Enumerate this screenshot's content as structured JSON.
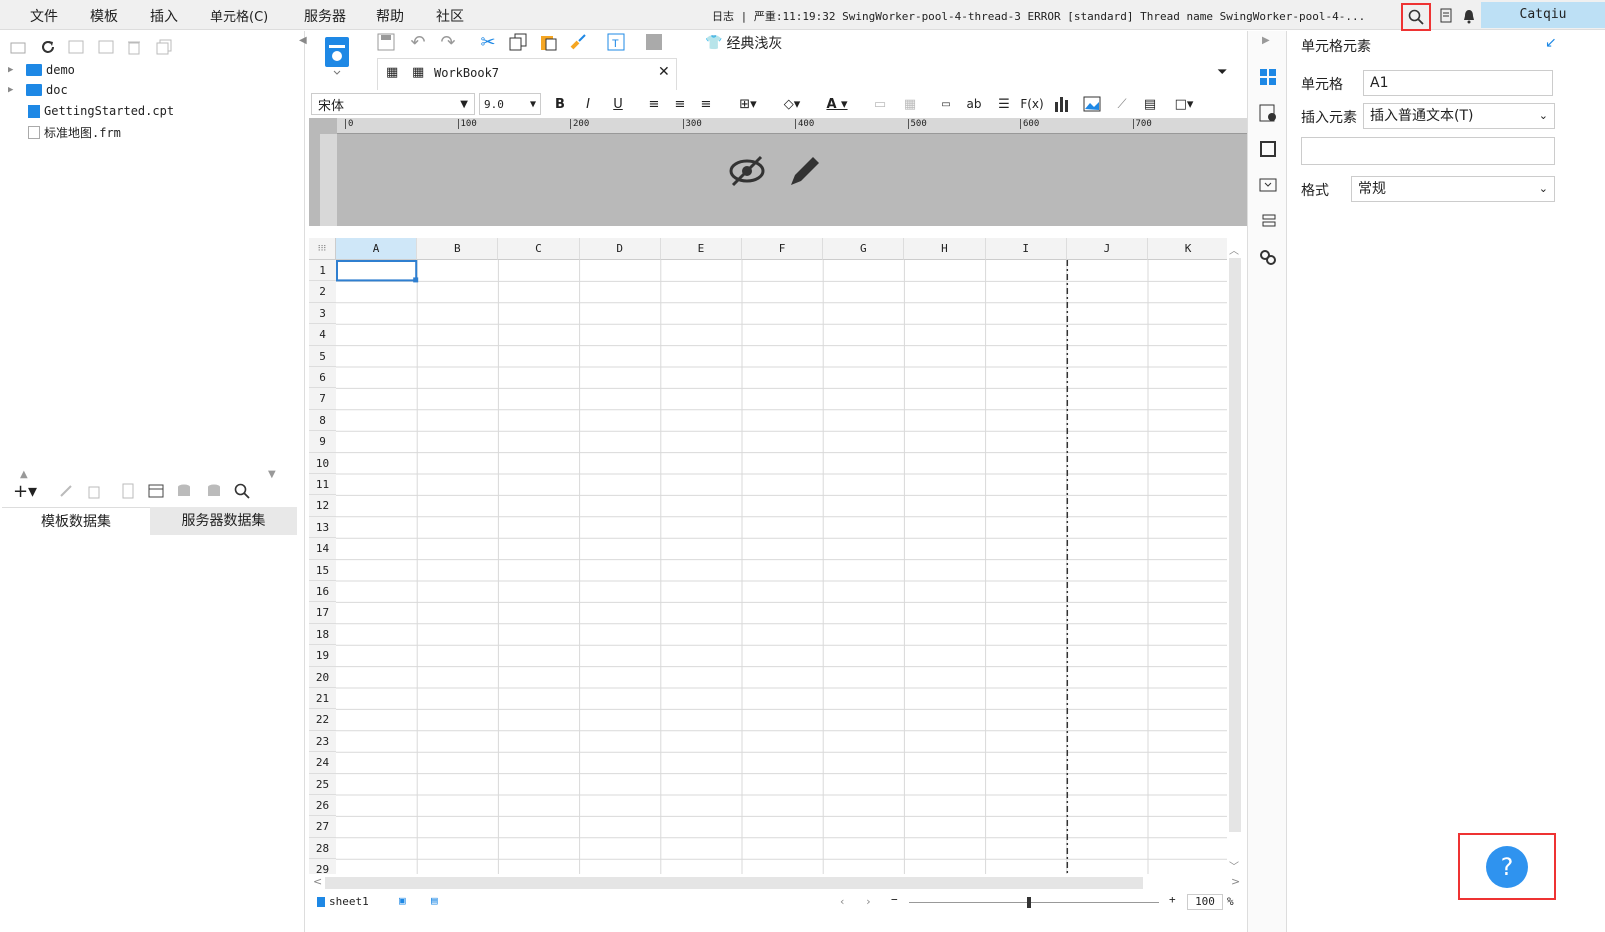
{
  "menu": [
    "文件",
    "模板",
    "插入",
    "单元格(C)",
    "服务器",
    "帮助",
    "社区"
  ],
  "log_text": "日志 | 严重:11:19:32 SwingWorker-pool-4-thread-3 ERROR [standard] Thread name SwingWorker-pool-4-...",
  "user": "Catqiu",
  "tree": [
    {
      "label": "demo",
      "type": "folder"
    },
    {
      "label": "doc",
      "type": "folder"
    },
    {
      "label": "GettingStarted.cpt",
      "type": "file"
    },
    {
      "label": "标准地图.frm",
      "type": "file"
    }
  ],
  "dataset_tabs": [
    "模板数据集",
    "服务器数据集"
  ],
  "theme_label": "经典浅灰",
  "workbook_tab": "WorkBook7",
  "font_name": "宋体",
  "font_size": "9.0",
  "ruler_ticks": [
    "0",
    "100",
    "200",
    "300",
    "400",
    "500",
    "600",
    "700"
  ],
  "columns": [
    "A",
    "B",
    "C",
    "D",
    "E",
    "F",
    "G",
    "H",
    "I",
    "J",
    "K"
  ],
  "rows": [
    "1",
    "2",
    "3",
    "4",
    "5",
    "6",
    "7",
    "8",
    "9",
    "10",
    "11",
    "12",
    "13",
    "14",
    "15",
    "16",
    "17",
    "18",
    "19",
    "20",
    "21",
    "22",
    "23",
    "24",
    "25",
    "26",
    "27",
    "28",
    "29"
  ],
  "sheet_name": "sheet1",
  "zoom": "100",
  "zoom_unit": "%",
  "panel_title": "单元格元素",
  "props": {
    "cell_label": "单元格",
    "cell_value": "A1",
    "insert_label": "插入元素",
    "insert_value": "插入普通文本(T)",
    "format_label": "格式",
    "format_value": "常规"
  },
  "help_glyph": "?",
  "colors": {
    "accent": "#2f93ef",
    "highlight": "#e33333",
    "selected_col": "#cfe7f8"
  }
}
